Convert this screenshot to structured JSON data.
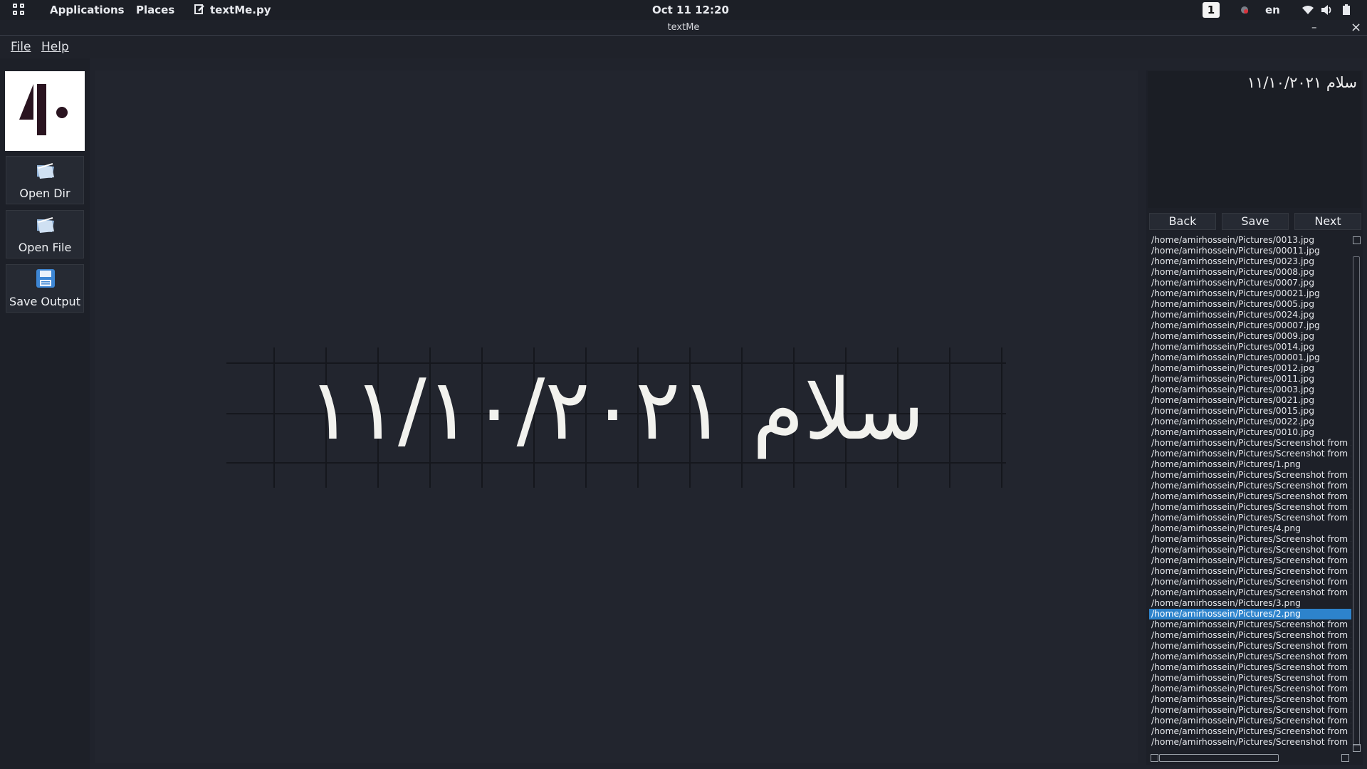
{
  "topbar": {
    "applications": "Applications",
    "places": "Places",
    "active_app": "textMe.py",
    "datetime": "Oct 11  12:20",
    "workspace": "1",
    "language": "en"
  },
  "window": {
    "title": "textMe",
    "minimize": "–",
    "close": "×"
  },
  "menu": {
    "file": "File",
    "help": "Help"
  },
  "sidebar": {
    "open_dir": "Open Dir",
    "open_file": "Open File",
    "save_output": "Save Output"
  },
  "canvas": {
    "image_text": "سلام ۱۱/۱۰/۲۰۲۱"
  },
  "result": {
    "text": "سلام ۱۱/۱۰/۲۰۲۱"
  },
  "nav": {
    "back": "Back",
    "save": "Save",
    "next": "Next"
  },
  "files": [
    "/home/amirhossein/Pictures/0013.jpg",
    "/home/amirhossein/Pictures/00011.jpg",
    "/home/amirhossein/Pictures/0023.jpg",
    "/home/amirhossein/Pictures/0008.jpg",
    "/home/amirhossein/Pictures/0007.jpg",
    "/home/amirhossein/Pictures/00021.jpg",
    "/home/amirhossein/Pictures/0005.jpg",
    "/home/amirhossein/Pictures/0024.jpg",
    "/home/amirhossein/Pictures/00007.jpg",
    "/home/amirhossein/Pictures/0009.jpg",
    "/home/amirhossein/Pictures/0014.jpg",
    "/home/amirhossein/Pictures/00001.jpg",
    "/home/amirhossein/Pictures/0012.jpg",
    "/home/amirhossein/Pictures/0011.jpg",
    "/home/amirhossein/Pictures/0003.jpg",
    "/home/amirhossein/Pictures/0021.jpg",
    "/home/amirhossein/Pictures/0015.jpg",
    "/home/amirhossein/Pictures/0022.jpg",
    "/home/amirhossein/Pictures/0010.jpg",
    "/home/amirhossein/Pictures/Screenshot from 2",
    "/home/amirhossein/Pictures/Screenshot from 2",
    "/home/amirhossein/Pictures/1.png",
    "/home/amirhossein/Pictures/Screenshot from 2",
    "/home/amirhossein/Pictures/Screenshot from 2",
    "/home/amirhossein/Pictures/Screenshot from 2",
    "/home/amirhossein/Pictures/Screenshot from 2",
    "/home/amirhossein/Pictures/Screenshot from 2",
    "/home/amirhossein/Pictures/4.png",
    "/home/amirhossein/Pictures/Screenshot from 2",
    "/home/amirhossein/Pictures/Screenshot from 2",
    "/home/amirhossein/Pictures/Screenshot from 2",
    "/home/amirhossein/Pictures/Screenshot from 2",
    "/home/amirhossein/Pictures/Screenshot from 2",
    "/home/amirhossein/Pictures/Screenshot from 2",
    "/home/amirhossein/Pictures/3.png",
    "/home/amirhossein/Pictures/2.png",
    "/home/amirhossein/Pictures/Screenshot from 2",
    "/home/amirhossein/Pictures/Screenshot from 2",
    "/home/amirhossein/Pictures/Screenshot from 2",
    "/home/amirhossein/Pictures/Screenshot from 2",
    "/home/amirhossein/Pictures/Screenshot from 2",
    "/home/amirhossein/Pictures/Screenshot from 2",
    "/home/amirhossein/Pictures/Screenshot from 2",
    "/home/amirhossein/Pictures/Screenshot from 2",
    "/home/amirhossein/Pictures/Screenshot from 2",
    "/home/amirhossein/Pictures/Screenshot from 2",
    "/home/amirhossein/Pictures/Screenshot from 2",
    "/home/amirhossein/Pictures/Screenshot from 2"
  ],
  "selected_file_index": 35,
  "icons": {
    "apps_grid": "grid-icon",
    "editor": "editor-icon",
    "record": "record-icon",
    "wifi": "wifi-icon",
    "volume": "volume-icon",
    "battery": "battery-icon",
    "folder": "folder-icon",
    "save": "floppy-disk-icon"
  },
  "colors": {
    "selection": "#2d83cc",
    "logo_mark": "#2a1420"
  }
}
